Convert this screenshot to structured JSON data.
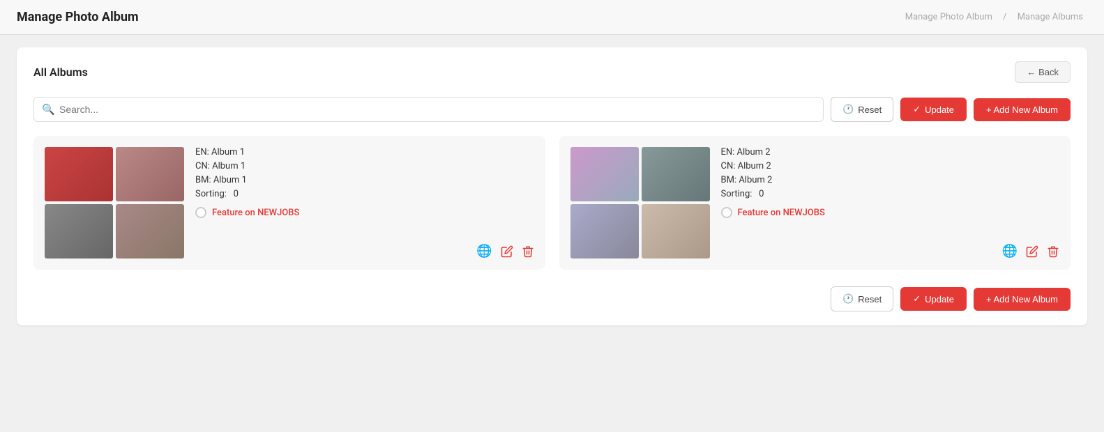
{
  "header": {
    "title": "Manage Photo Album",
    "breadcrumb": {
      "part1": "Manage Photo Album",
      "separator": "/",
      "part2": "Manage Albums"
    }
  },
  "card": {
    "title": "All Albums",
    "back_label": "← Back"
  },
  "toolbar": {
    "search_placeholder": "Search...",
    "reset_label": "Reset",
    "update_label": "Update",
    "add_label": "+ Add New Album"
  },
  "albums": [
    {
      "id": 1,
      "en_name": "EN: Album 1",
      "cn_name": "CN: Album 1",
      "bm_name": "BM: Album 1",
      "sorting_label": "Sorting:",
      "sorting_value": "0",
      "feature_label": "Feature on NEWJOBS",
      "images": [
        "img-1",
        "img-2",
        "img-3",
        "img-4"
      ]
    },
    {
      "id": 2,
      "en_name": "EN: Album 2",
      "cn_name": "CN: Album 2",
      "bm_name": "BM: Album 2",
      "sorting_label": "Sorting:",
      "sorting_value": "0",
      "feature_label": "Feature on NEWJOBS",
      "images": [
        "img-5",
        "img-6",
        "img-7",
        "img-8"
      ]
    }
  ],
  "icons": {
    "search": "🔍",
    "reset_clock": "🕐",
    "check": "✓",
    "globe": "🌐",
    "edit": "✏",
    "delete": "🗑"
  }
}
